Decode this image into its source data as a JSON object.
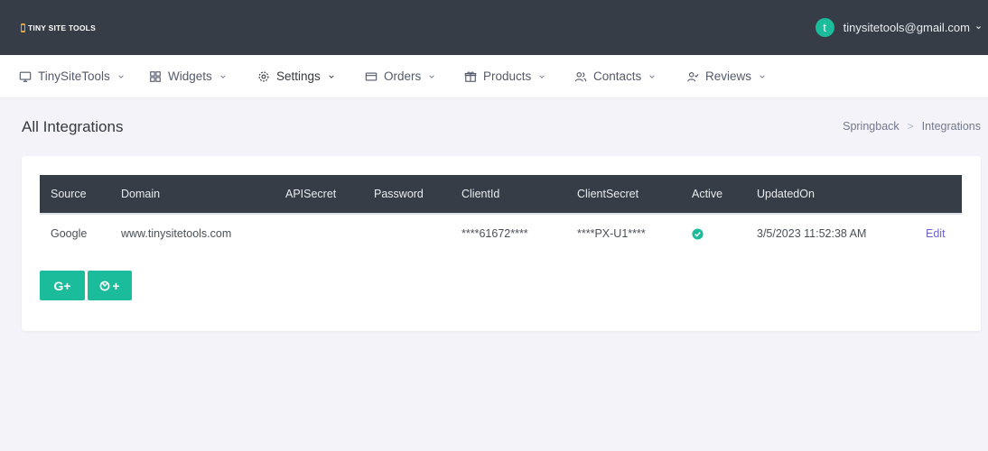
{
  "brand": {
    "logo_text": "TINY SITE TOOLS"
  },
  "user": {
    "avatar_letter": "t",
    "email": "tinysitetools@gmail.com"
  },
  "nav": [
    {
      "label": "TinySiteTools",
      "icon": "monitor-icon"
    },
    {
      "label": "Widgets",
      "icon": "grid-icon"
    },
    {
      "label": "Settings",
      "icon": "gear-icon"
    },
    {
      "label": "Orders",
      "icon": "credit-card-icon"
    },
    {
      "label": "Products",
      "icon": "gift-icon"
    },
    {
      "label": "Contacts",
      "icon": "users-icon"
    },
    {
      "label": "Reviews",
      "icon": "user-check-icon"
    }
  ],
  "page": {
    "title": "All Integrations"
  },
  "breadcrumb": {
    "parent": "Springback",
    "separator": ">",
    "current": "Integrations"
  },
  "table": {
    "headers": [
      "Source",
      "Domain",
      "APISecret",
      "Password",
      "ClientId",
      "ClientSecret",
      "Active",
      "UpdatedOn",
      ""
    ],
    "rows": [
      {
        "source": "Google",
        "domain": "www.tinysitetools.com",
        "api_secret": "",
        "password": "",
        "client_id": "****61672****",
        "client_secret": "****PX-U1****",
        "active": true,
        "updated_on": "3/5/2023 11:52:38 AM",
        "action": "Edit"
      }
    ]
  },
  "buttons": {
    "google": "G+",
    "other": "+"
  },
  "colors": {
    "topbar": "#363d47",
    "accent": "#1abc9c",
    "link": "#6c63d4"
  }
}
